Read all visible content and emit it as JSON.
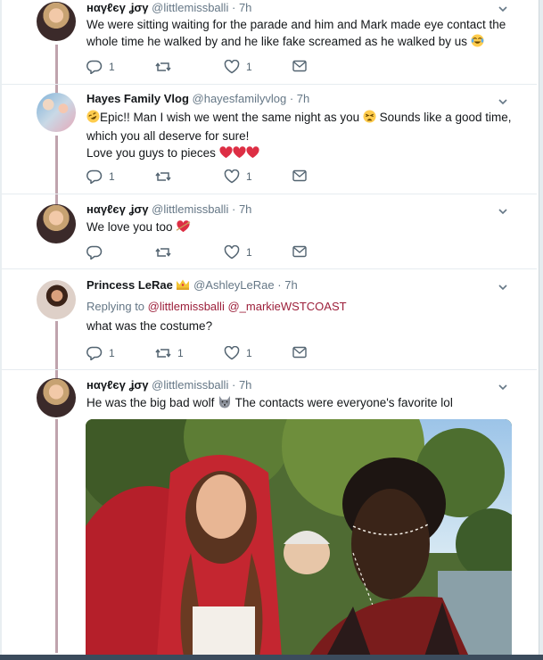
{
  "tweets": [
    {
      "name": "ʜαγℓєγ ʝσγ",
      "handle": "@littlemissballi",
      "time": "7h",
      "text": "We were sitting waiting for the parade and him and Mark made eye contact the whole time he walked by and he like fake screamed as he walked by us",
      "replies": "1",
      "retweets": "",
      "likes": "1"
    },
    {
      "name": "Hayes Family Vlog",
      "handle": "@hayesfamilyvlog",
      "time": "7h",
      "line1a": "Epic!! Man I wish we went the same night as you",
      "line1b": "Sounds like a good time,",
      "line2": "which you all deserve for sure!",
      "line3": "Love you guys to pieces",
      "replies": "1",
      "retweets": "",
      "likes": "1"
    },
    {
      "name": "ʜαγℓєγ ʝσγ",
      "handle": "@littlemissballi",
      "time": "7h",
      "text": "We love you too",
      "replies": "",
      "retweets": "",
      "likes": "1"
    },
    {
      "name": "Princess LeRae",
      "handle": "@AshleyLeRae",
      "time": "7h",
      "replying_prefix": "Replying to",
      "replying_to_1": "@littlemissballi",
      "replying_to_2": "@_markieWSTCOAST",
      "text": "what was the costume?",
      "replies": "1",
      "retweets": "1",
      "likes": "1"
    },
    {
      "name": "ʜαγℓєγ ʝσγ",
      "handle": "@littlemissballi",
      "time": "7h",
      "text_a": "He was the big bad wolf",
      "text_b": "The contacts were everyone's favorite lol"
    }
  ],
  "separator": "·",
  "colors": {
    "thread_line": "#bfa3ad",
    "mention": "#9c1f3a",
    "muted": "#657786",
    "heart_emoji": "#e0245e"
  },
  "icons": [
    "reply-icon",
    "retweet-icon",
    "like-icon",
    "direct-message-icon",
    "chevron-down-icon",
    "crown-emoji-icon",
    "wolf-emoji-icon",
    "face-with-tears-of-joy-emoji-icon",
    "tired-face-emoji-icon",
    "rofl-emoji-icon",
    "red-heart-emoji-icon",
    "heart-with-arrow-emoji-icon"
  ]
}
